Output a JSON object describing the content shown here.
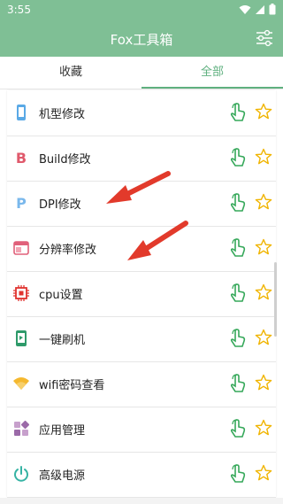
{
  "status": {
    "time": "3:55"
  },
  "app": {
    "title": "Fox工具箱"
  },
  "tabs": [
    {
      "label": "收藏"
    },
    {
      "label": "全部"
    }
  ],
  "items": [
    {
      "label": "机型修改",
      "icon": "phone-icon"
    },
    {
      "label": "Build修改",
      "icon": "letter-b-icon"
    },
    {
      "label": "DPI修改",
      "icon": "letter-p-icon"
    },
    {
      "label": "分辨率修改",
      "icon": "window-icon"
    },
    {
      "label": "cpu设置",
      "icon": "cpu-icon"
    },
    {
      "label": "一键刷机",
      "icon": "flash-phone-icon"
    },
    {
      "label": "wifi密码查看",
      "icon": "wifi-icon"
    },
    {
      "label": "应用管理",
      "icon": "apps-grid-icon"
    },
    {
      "label": "高级电源",
      "icon": "power-icon"
    }
  ],
  "colors": {
    "primary": "#7fbf95",
    "accent": "#5fb07f",
    "star": "#f0b400",
    "arrow": "#e23a2b"
  }
}
